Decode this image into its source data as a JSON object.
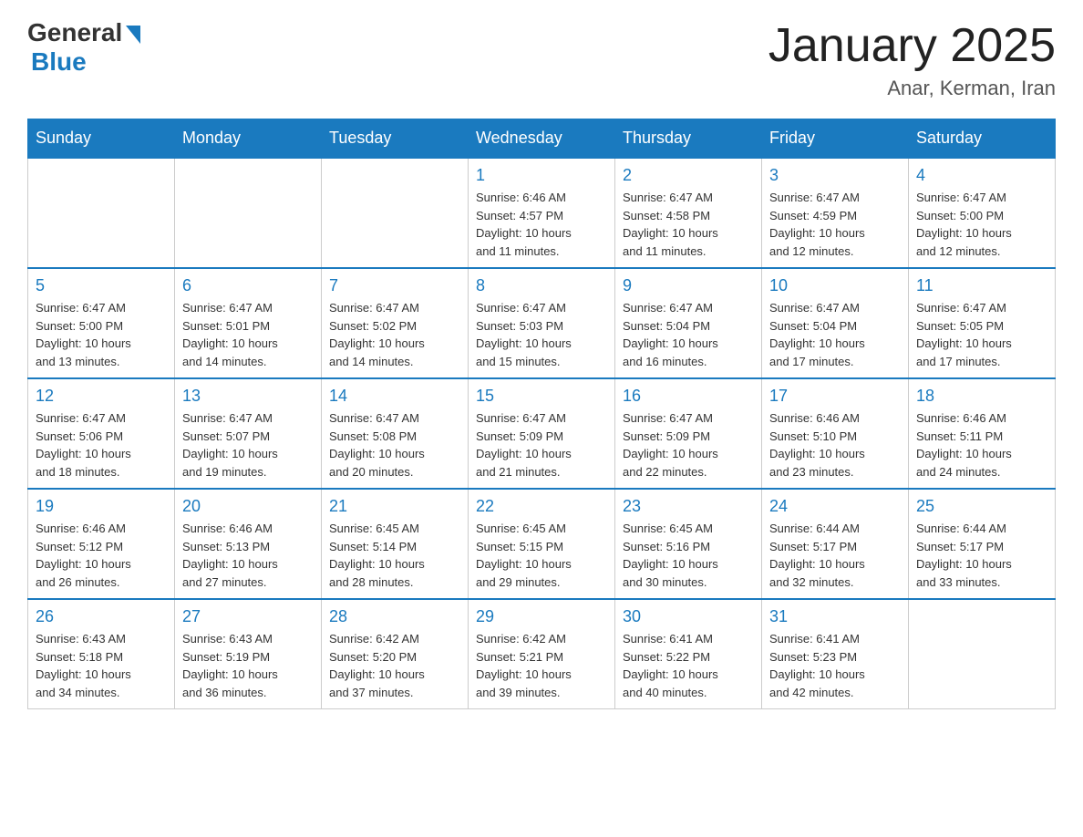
{
  "header": {
    "logo_general": "General",
    "logo_blue": "Blue",
    "title": "January 2025",
    "subtitle": "Anar, Kerman, Iran"
  },
  "days_of_week": [
    "Sunday",
    "Monday",
    "Tuesday",
    "Wednesday",
    "Thursday",
    "Friday",
    "Saturday"
  ],
  "weeks": [
    [
      {
        "day": "",
        "info": ""
      },
      {
        "day": "",
        "info": ""
      },
      {
        "day": "",
        "info": ""
      },
      {
        "day": "1",
        "info": "Sunrise: 6:46 AM\nSunset: 4:57 PM\nDaylight: 10 hours\nand 11 minutes."
      },
      {
        "day": "2",
        "info": "Sunrise: 6:47 AM\nSunset: 4:58 PM\nDaylight: 10 hours\nand 11 minutes."
      },
      {
        "day": "3",
        "info": "Sunrise: 6:47 AM\nSunset: 4:59 PM\nDaylight: 10 hours\nand 12 minutes."
      },
      {
        "day": "4",
        "info": "Sunrise: 6:47 AM\nSunset: 5:00 PM\nDaylight: 10 hours\nand 12 minutes."
      }
    ],
    [
      {
        "day": "5",
        "info": "Sunrise: 6:47 AM\nSunset: 5:00 PM\nDaylight: 10 hours\nand 13 minutes."
      },
      {
        "day": "6",
        "info": "Sunrise: 6:47 AM\nSunset: 5:01 PM\nDaylight: 10 hours\nand 14 minutes."
      },
      {
        "day": "7",
        "info": "Sunrise: 6:47 AM\nSunset: 5:02 PM\nDaylight: 10 hours\nand 14 minutes."
      },
      {
        "day": "8",
        "info": "Sunrise: 6:47 AM\nSunset: 5:03 PM\nDaylight: 10 hours\nand 15 minutes."
      },
      {
        "day": "9",
        "info": "Sunrise: 6:47 AM\nSunset: 5:04 PM\nDaylight: 10 hours\nand 16 minutes."
      },
      {
        "day": "10",
        "info": "Sunrise: 6:47 AM\nSunset: 5:04 PM\nDaylight: 10 hours\nand 17 minutes."
      },
      {
        "day": "11",
        "info": "Sunrise: 6:47 AM\nSunset: 5:05 PM\nDaylight: 10 hours\nand 17 minutes."
      }
    ],
    [
      {
        "day": "12",
        "info": "Sunrise: 6:47 AM\nSunset: 5:06 PM\nDaylight: 10 hours\nand 18 minutes."
      },
      {
        "day": "13",
        "info": "Sunrise: 6:47 AM\nSunset: 5:07 PM\nDaylight: 10 hours\nand 19 minutes."
      },
      {
        "day": "14",
        "info": "Sunrise: 6:47 AM\nSunset: 5:08 PM\nDaylight: 10 hours\nand 20 minutes."
      },
      {
        "day": "15",
        "info": "Sunrise: 6:47 AM\nSunset: 5:09 PM\nDaylight: 10 hours\nand 21 minutes."
      },
      {
        "day": "16",
        "info": "Sunrise: 6:47 AM\nSunset: 5:09 PM\nDaylight: 10 hours\nand 22 minutes."
      },
      {
        "day": "17",
        "info": "Sunrise: 6:46 AM\nSunset: 5:10 PM\nDaylight: 10 hours\nand 23 minutes."
      },
      {
        "day": "18",
        "info": "Sunrise: 6:46 AM\nSunset: 5:11 PM\nDaylight: 10 hours\nand 24 minutes."
      }
    ],
    [
      {
        "day": "19",
        "info": "Sunrise: 6:46 AM\nSunset: 5:12 PM\nDaylight: 10 hours\nand 26 minutes."
      },
      {
        "day": "20",
        "info": "Sunrise: 6:46 AM\nSunset: 5:13 PM\nDaylight: 10 hours\nand 27 minutes."
      },
      {
        "day": "21",
        "info": "Sunrise: 6:45 AM\nSunset: 5:14 PM\nDaylight: 10 hours\nand 28 minutes."
      },
      {
        "day": "22",
        "info": "Sunrise: 6:45 AM\nSunset: 5:15 PM\nDaylight: 10 hours\nand 29 minutes."
      },
      {
        "day": "23",
        "info": "Sunrise: 6:45 AM\nSunset: 5:16 PM\nDaylight: 10 hours\nand 30 minutes."
      },
      {
        "day": "24",
        "info": "Sunrise: 6:44 AM\nSunset: 5:17 PM\nDaylight: 10 hours\nand 32 minutes."
      },
      {
        "day": "25",
        "info": "Sunrise: 6:44 AM\nSunset: 5:17 PM\nDaylight: 10 hours\nand 33 minutes."
      }
    ],
    [
      {
        "day": "26",
        "info": "Sunrise: 6:43 AM\nSunset: 5:18 PM\nDaylight: 10 hours\nand 34 minutes."
      },
      {
        "day": "27",
        "info": "Sunrise: 6:43 AM\nSunset: 5:19 PM\nDaylight: 10 hours\nand 36 minutes."
      },
      {
        "day": "28",
        "info": "Sunrise: 6:42 AM\nSunset: 5:20 PM\nDaylight: 10 hours\nand 37 minutes."
      },
      {
        "day": "29",
        "info": "Sunrise: 6:42 AM\nSunset: 5:21 PM\nDaylight: 10 hours\nand 39 minutes."
      },
      {
        "day": "30",
        "info": "Sunrise: 6:41 AM\nSunset: 5:22 PM\nDaylight: 10 hours\nand 40 minutes."
      },
      {
        "day": "31",
        "info": "Sunrise: 6:41 AM\nSunset: 5:23 PM\nDaylight: 10 hours\nand 42 minutes."
      },
      {
        "day": "",
        "info": ""
      }
    ]
  ]
}
